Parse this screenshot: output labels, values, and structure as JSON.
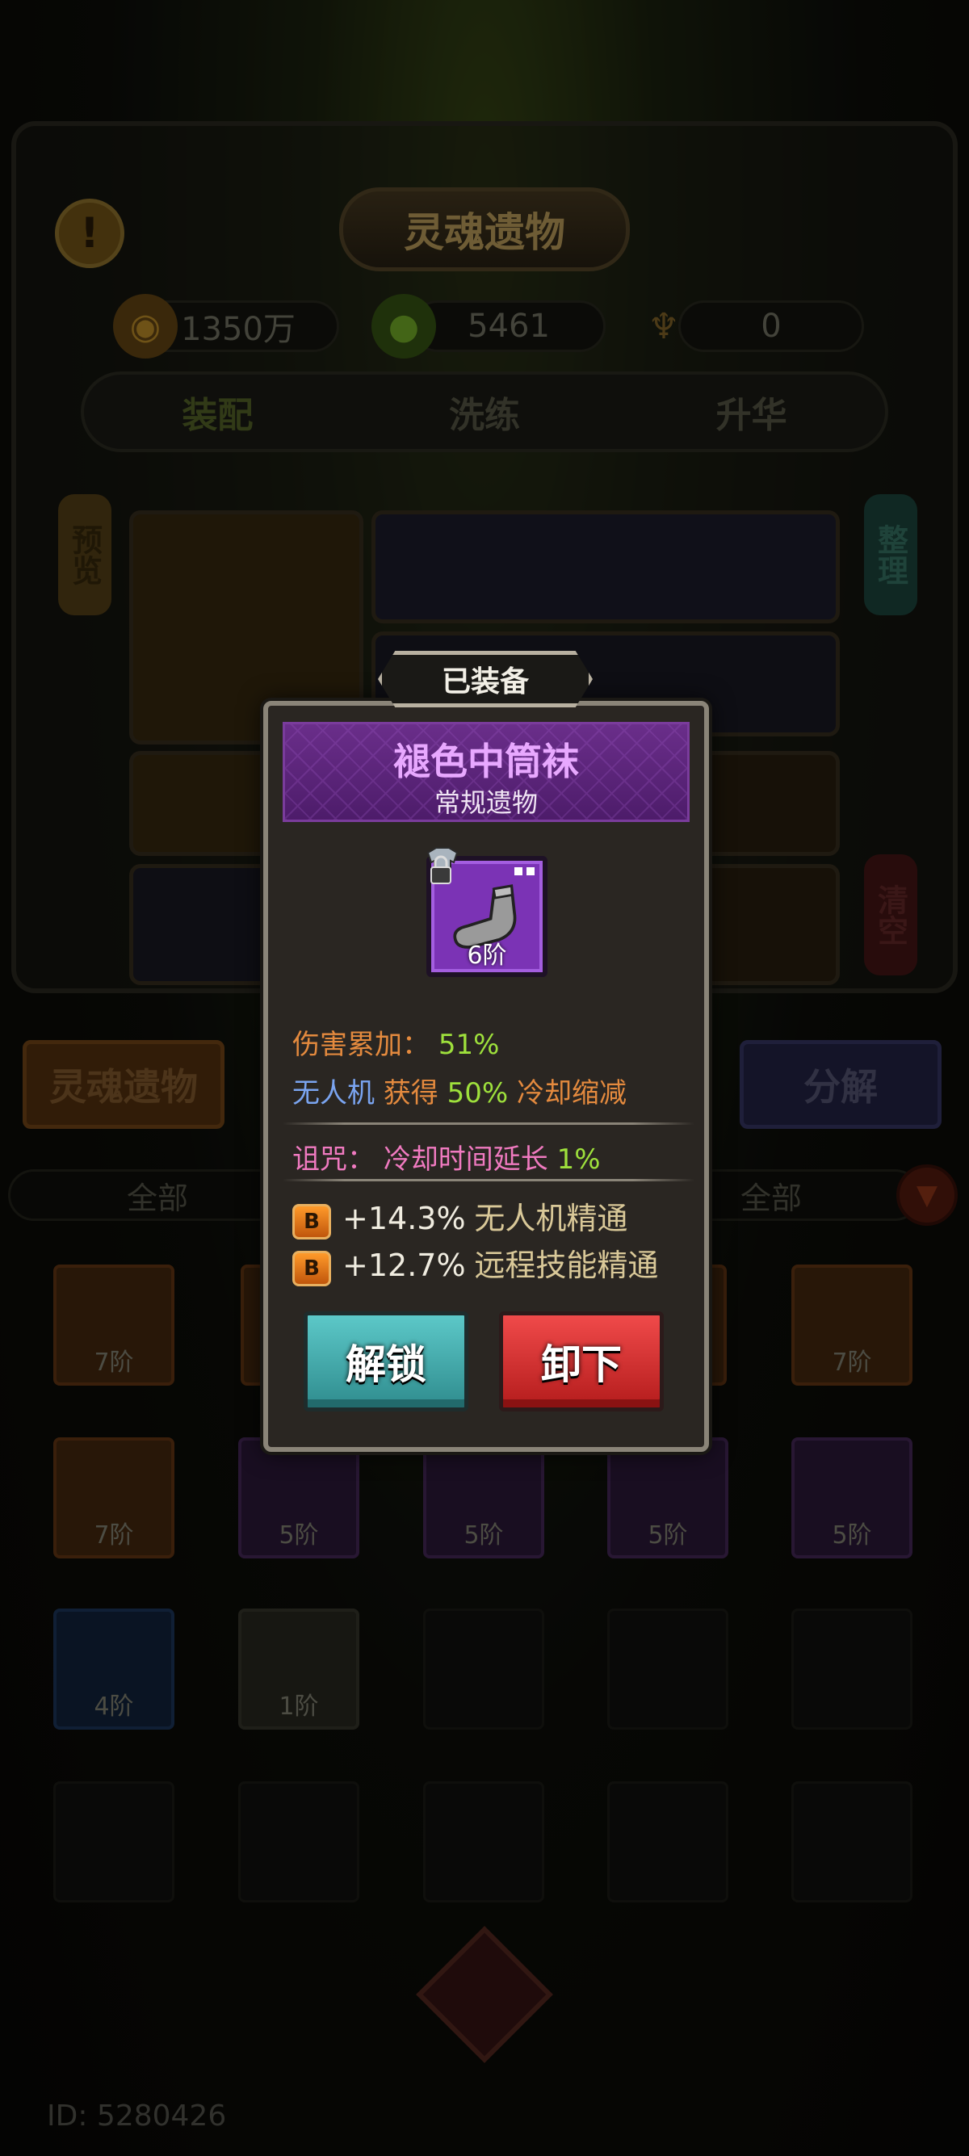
{
  "screen": {
    "title": "灵魂遗物",
    "alert_icon": "!",
    "resources": [
      {
        "icon": "coin-icon",
        "value": "1350万"
      },
      {
        "icon": "soul-icon",
        "value": "5461"
      },
      {
        "icon": "tooth-icon",
        "value": "0"
      }
    ],
    "tabs": [
      "装配",
      "洗练",
      "升华"
    ],
    "side_left": "预览",
    "side_right_top": "整理",
    "side_right_bottom": "清空",
    "bar_left": "灵魂遗物",
    "bar_right": "分解",
    "filter_left": "全部",
    "filter_right": "全部",
    "grid": [
      {
        "tier": "7阶",
        "rarity": "orange"
      },
      {
        "tier": "7阶",
        "rarity": "orange"
      },
      {
        "tier": "7阶",
        "rarity": "orange"
      },
      {
        "tier": "5阶",
        "rarity": "purple"
      },
      {
        "tier": "5阶",
        "rarity": "purple"
      },
      {
        "tier": "5阶",
        "rarity": "purple"
      },
      {
        "tier": "5阶",
        "rarity": "purple"
      },
      {
        "tier": "4阶",
        "rarity": "blue"
      },
      {
        "tier": "1阶",
        "rarity": "gray"
      }
    ],
    "player_id": "ID: 5280426"
  },
  "popup": {
    "tag": "已装备",
    "item_name": "褪色中筒袜",
    "item_type": "常规遗物",
    "item_tier": "6阶",
    "item_color": "#7b33b5",
    "stats": {
      "line1_label": "伤害累加：",
      "line1_value": "51%",
      "line2_a": "无人机",
      "line2_b": "获得",
      "line2_value": "50%",
      "line2_c": "冷却缩减",
      "curse_label": "诅咒：",
      "curse_text": "冷却时间延长",
      "curse_value": "1%",
      "bonus": [
        {
          "badge": "B",
          "value": "+14.3%",
          "text": "无人机精通"
        },
        {
          "badge": "B",
          "value": "+12.7%",
          "text": "远程技能精通"
        }
      ]
    },
    "buttons": {
      "unlock": "解锁",
      "unequip": "卸下"
    }
  }
}
